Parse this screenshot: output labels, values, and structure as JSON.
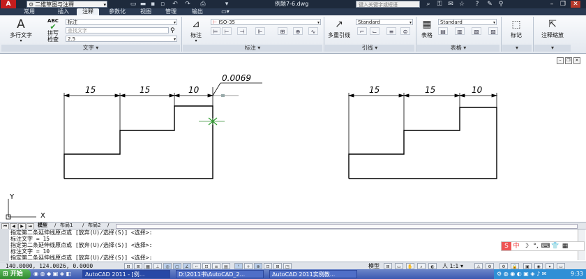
{
  "titlebar": {
    "app_icon": "A",
    "workspace": "二维草图与注释",
    "document_title": "例题7-6.dwg",
    "search_placeholder": "键入关键字或短语",
    "qat_icons": [
      "new-icon",
      "open-icon",
      "save-icon",
      "undo-icon",
      "redo-icon",
      "print-icon"
    ]
  },
  "ribbon_tabs": [
    "常用",
    "插入",
    "注释",
    "参数化",
    "视图",
    "管理",
    "输出"
  ],
  "ribbon_active_tab": "注释",
  "ribbon": {
    "text_panel": {
      "multiline_text": "多行文字",
      "spell_check": "拼写检查",
      "spell_check_line1": "拼写",
      "spell_check_line2": "检查",
      "abc_badge": "ABC",
      "text_style": "标注",
      "find_text_placeholder": "查找文字",
      "text_height": "2.5",
      "title": "文字"
    },
    "dim_panel": {
      "button": "标注",
      "dim_style": "ISO-35",
      "title": "标注"
    },
    "leader_panel": {
      "button": "多重引线",
      "style": "Standard",
      "title": "引线"
    },
    "table_panel": {
      "button": "表格",
      "style": "Standard",
      "title": "表格"
    },
    "markup_panel": {
      "button": "标记"
    },
    "scale_panel": {
      "button": "注释缩放"
    }
  },
  "drawing": {
    "left": {
      "dims": [
        "15",
        "15",
        "10"
      ],
      "leader_text": "0.0069"
    },
    "right": {
      "dims": [
        "15",
        "15",
        "10"
      ]
    },
    "ucs": {
      "x": "X",
      "y": "Y"
    }
  },
  "layout_tabs": [
    "模型",
    "布局1",
    "布局2"
  ],
  "active_layout": "模型",
  "command_lines": [
    "指定第二条延伸线原点或 [放弃(U)/选择(S)] <选择>:",
    "标注文字 = 15",
    "指定第二条延伸线原点或 [放弃(U)/选择(S)] <选择>:",
    "标注文字 = 10",
    "指定第二条延伸线原点或 [放弃(U)/选择(S)] <选择>:"
  ],
  "ime_bar": [
    "S",
    "中",
    "☽",
    "°,",
    "⌨",
    "👕",
    "▦"
  ],
  "status": {
    "coordinates": "140.0000, 124.0026, 0.0000",
    "model_label": "模型",
    "annotation_scale": "人 1:1 ▾"
  },
  "taskbar": {
    "start": "开始",
    "tasks": [
      "AutoCAD 2011 - [例...",
      "D:\\2011书\\AutoCAD_2...",
      "AutoCAD 2011实例教..."
    ],
    "clock": "9:33"
  }
}
